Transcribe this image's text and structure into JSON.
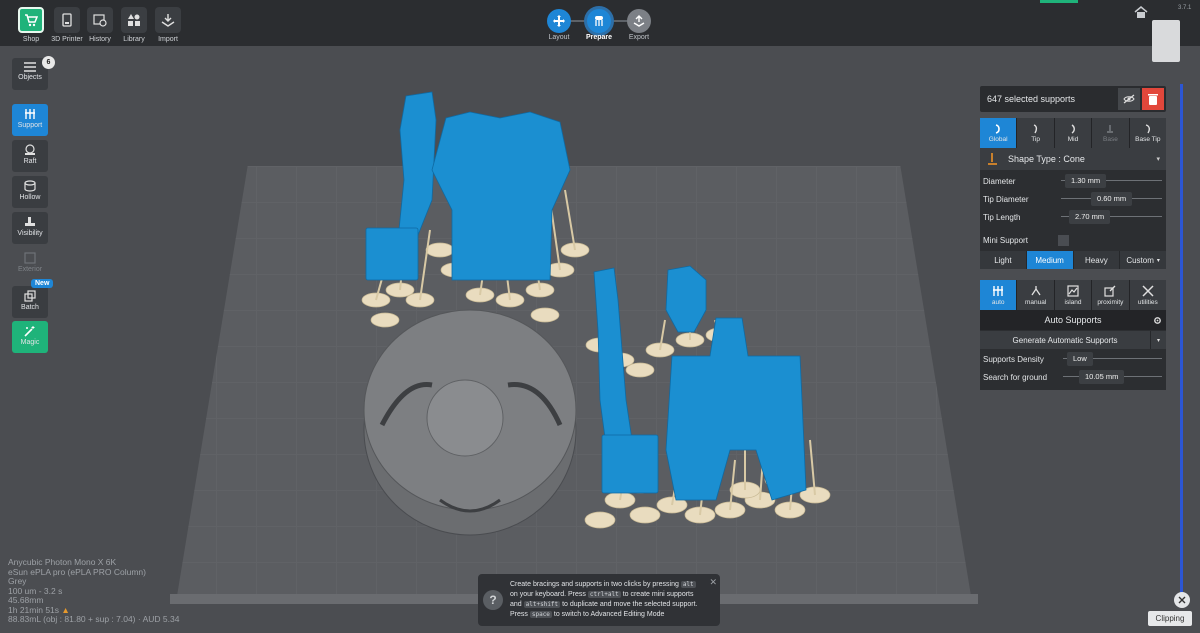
{
  "toolbar": {
    "buttons": [
      {
        "label": "Shop",
        "icon": "cart-icon",
        "active": true
      },
      {
        "label": "3D Printer",
        "icon": "printer-icon"
      },
      {
        "label": "History",
        "icon": "history-icon"
      },
      {
        "label": "Library",
        "icon": "library-icon"
      },
      {
        "label": "Import",
        "icon": "import-icon"
      }
    ],
    "steps": [
      {
        "label": "Layout",
        "state": "done"
      },
      {
        "label": "Prepare",
        "state": "active"
      },
      {
        "label": "Export",
        "state": "next"
      }
    ],
    "version": "3.7.1"
  },
  "left_tools": {
    "objects_label": "Objects",
    "objects_count": "6",
    "support_label": "Support",
    "raft_label": "Raft",
    "hollow_label": "Hollow",
    "visibility_label": "Visibility",
    "exterior_label": "Exterior",
    "batch_label": "Batch",
    "batch_badge": "New",
    "magic_label": "Magic"
  },
  "selection": {
    "text": "647 selected supports"
  },
  "support_panel": {
    "tabs": [
      "Global",
      "Tip",
      "Mid",
      "Base",
      "Base Tip"
    ],
    "shape_type": "Shape Type : Cone",
    "diameter_label": "Diameter",
    "diameter_value": "1.30 mm",
    "tip_diameter_label": "Tip Diameter",
    "tip_diameter_value": "0.60 mm",
    "tip_length_label": "Tip Length",
    "tip_length_value": "2.70 mm",
    "mini_support_label": "Mini Support",
    "densities": [
      "Light",
      "Medium",
      "Heavy",
      "Custom"
    ],
    "density_active": "Medium"
  },
  "auto_panel": {
    "tabs": [
      "auto",
      "manual",
      "island",
      "proximity",
      "utilities"
    ],
    "title": "Auto Supports",
    "generate_label": "Generate Automatic Supports",
    "density_label": "Supports Density",
    "density_value": "Low",
    "ground_label": "Search for ground",
    "ground_value": "10.05 mm"
  },
  "printer_info": [
    "Anycubic Photon Mono X 6K",
    "eSun ePLA pro (ePLA PRO Column)",
    "Grey",
    "100 um - 3.2 s",
    "45.68mm",
    "1h 21min 51s",
    "88.83mL (obj : 81.80 + sup : 7.04) · AUD 5.34"
  ],
  "tip": {
    "line1_a": "Create bracings and supports in two clicks by pressing",
    "key_alt": "alt",
    "line2_a": "on your keyboard. Press",
    "key_ctrlalt": "ctrl+alt",
    "line2_b": "to create mini supports",
    "line3_a": "and",
    "key_altshift": "alt+shift",
    "line3_b": "to duplicate and move the selected support.",
    "line4_a": "Press",
    "key_space": "space",
    "line4_b": "to switch to Advanced Editing Mode"
  },
  "clipping_label": "Clipping",
  "colors": {
    "accent": "#1e86d6",
    "shop": "#1fb37a",
    "model": "#1b8fd1",
    "support": "#e9dcbf",
    "delete": "#e2473b"
  }
}
